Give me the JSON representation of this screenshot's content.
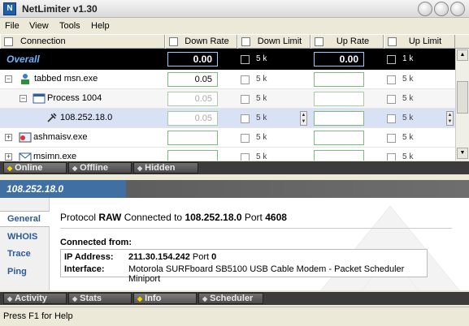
{
  "window": {
    "title": "NetLimiter v1.30"
  },
  "menu": [
    "File",
    "View",
    "Tools",
    "Help"
  ],
  "columns": {
    "connection": "Connection",
    "down_rate": "Down Rate",
    "down_limit": "Down Limit",
    "up_rate": "Up Rate",
    "up_limit": "Up Limit"
  },
  "overall": {
    "label": "Overall",
    "down_rate": "0.00",
    "down_limit": "5 k",
    "up_rate": "0.00",
    "up_limit": "1 k"
  },
  "rows": [
    {
      "name": "tabbed msn.exe",
      "expander": "−",
      "down_rate": "0.05",
      "down_limit": "5 k",
      "up_rate": "",
      "up_limit": "5 k"
    },
    {
      "name": "Process 1004",
      "expander": "−",
      "down_rate": "0.05",
      "down_limit": "5 k",
      "up_rate": "",
      "up_limit": "5 k"
    },
    {
      "name": "108.252.18.0",
      "expander": "",
      "down_rate": "0.05",
      "down_limit": "5 k",
      "up_rate": "",
      "up_limit": "5 k"
    },
    {
      "name": "ashmaisv.exe",
      "expander": "+",
      "down_rate": "",
      "down_limit": "5 k",
      "up_rate": "",
      "up_limit": "5 k"
    },
    {
      "name": "msimn.exe",
      "expander": "+",
      "down_rate": "",
      "down_limit": "5 k",
      "up_rate": "",
      "up_limit": "5 k"
    }
  ],
  "view_tabs": [
    "Online",
    "Offline",
    "Hidden"
  ],
  "detail": {
    "header": "108.252.18.0",
    "side": [
      "General",
      "WHOIS",
      "Trace",
      "Ping"
    ],
    "proto_label": "Protocol",
    "proto_value": "RAW",
    "connected_to_label": "Connected to",
    "connected_to_ip": "108.252.18.0",
    "port_label": "Port",
    "port_value": "4608",
    "connected_from": "Connected from:",
    "ip_label": "IP Address:",
    "ip_value": "211.30.154.242",
    "ip_port_label": "Port",
    "ip_port_value": "0",
    "iface_label": "Interface:",
    "iface_value": "Motorola SURFboard SB5100 USB Cable Modem - Packet Scheduler Miniport"
  },
  "bottom_tabs": [
    "Activity",
    "Stats",
    "Info",
    "Scheduler"
  ],
  "status": "Press F1 for Help",
  "colors": {
    "overall_bg": "#000000",
    "overall_label": "#6fb3ff",
    "detail_header": "#3f6fa3",
    "tab_active_marker": "#ffd400"
  }
}
